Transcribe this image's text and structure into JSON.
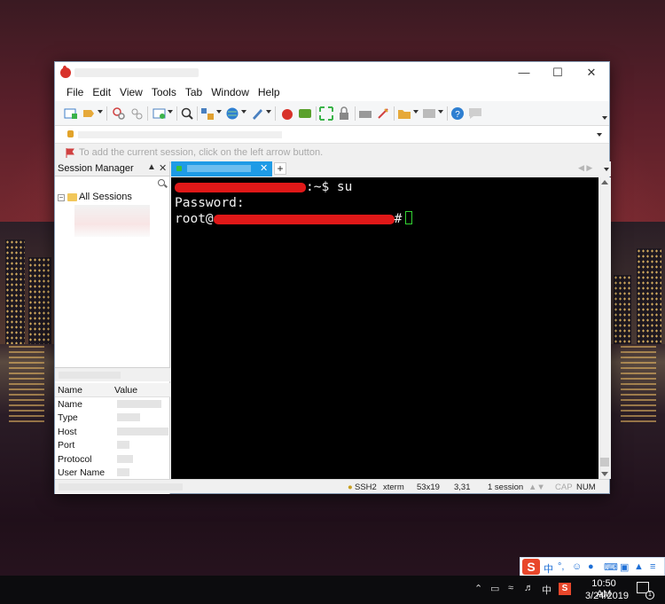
{
  "menu": [
    "File",
    "Edit",
    "View",
    "Tools",
    "Tab",
    "Window",
    "Help"
  ],
  "hint": "To add the current session, click on the left arrow button.",
  "session_manager": {
    "title": "Session Manager",
    "tree_root": "All Sessions",
    "props_headers": [
      "Name",
      "Value"
    ],
    "props_keys": [
      "Name",
      "Type",
      "Host",
      "Port",
      "Protocol",
      "User Name"
    ]
  },
  "terminal": {
    "line1_suffix": ":~$ su",
    "line2": "Password:",
    "line3_prefix": "root@",
    "line3_suffix": "#"
  },
  "status": {
    "protocol": "SSH2",
    "terminal": "xterm",
    "size": "53x19",
    "cursor": "3,31",
    "sessions": "1 session",
    "caps": "CAP",
    "num": "NUM"
  },
  "taskbar": {
    "time": "10:50 AM",
    "date": "3/24/2019",
    "ime_lang": "中",
    "ime_brand": "S",
    "notification_count": "1"
  }
}
